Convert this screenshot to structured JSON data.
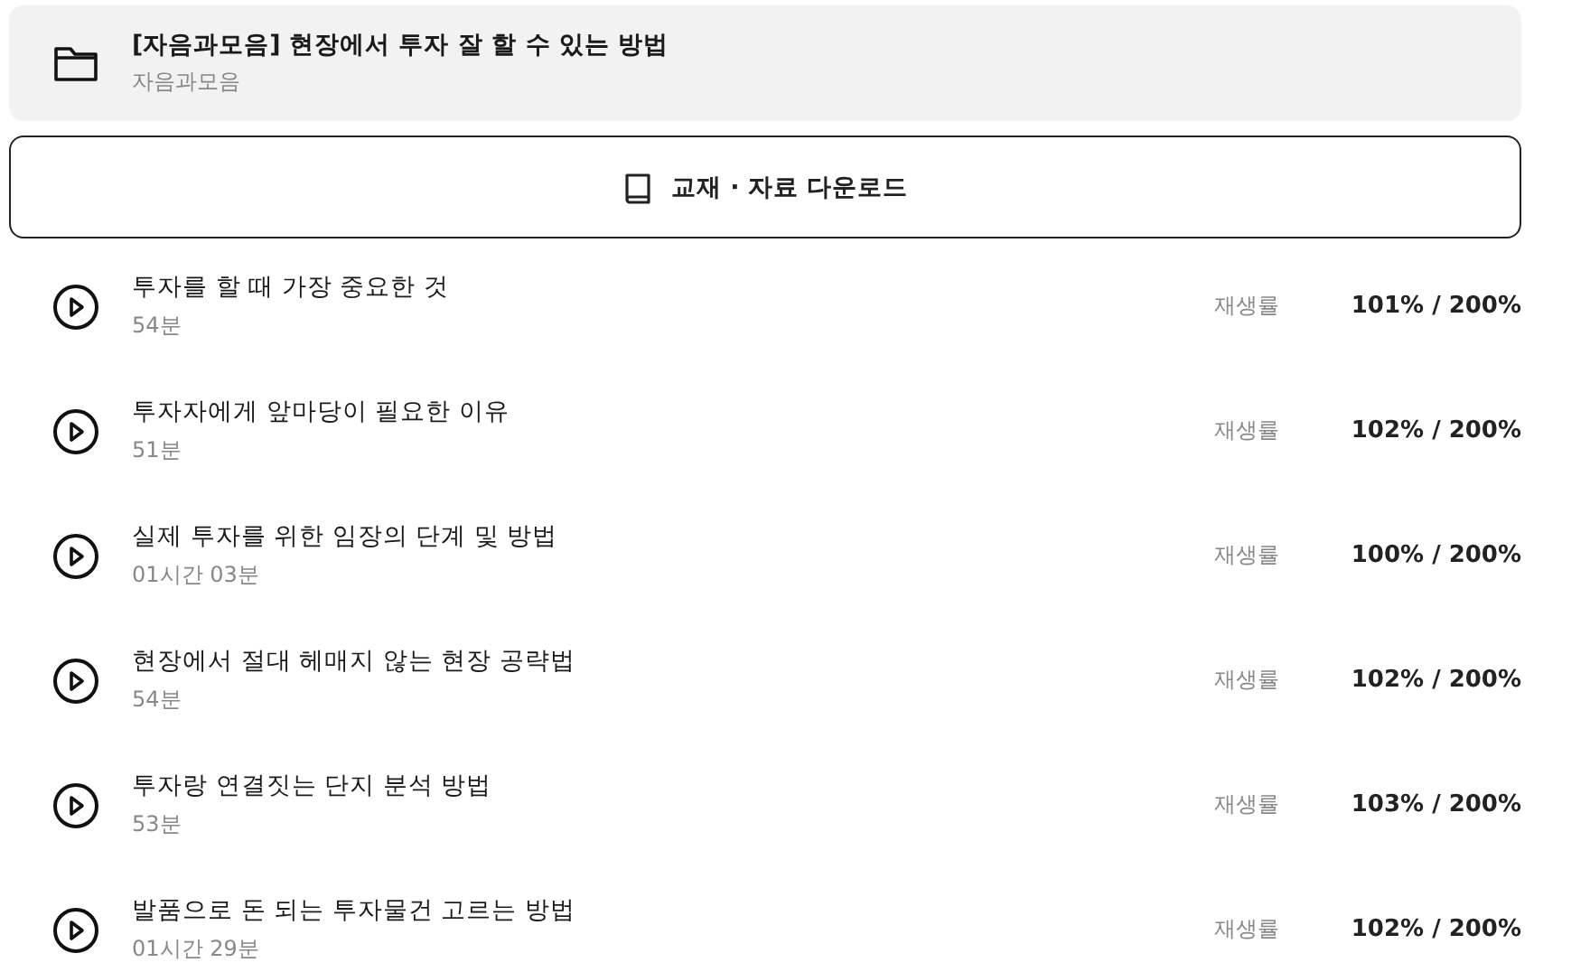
{
  "course": {
    "title": "[자음과모음] 현장에서 투자 잘 할 수 있는 방법",
    "publisher": "자음과모음"
  },
  "download_button": {
    "label": "교재 · 자료 다운로드"
  },
  "lessons": [
    {
      "title": "투자를 할 때 가장 중요한 것",
      "duration": "54분",
      "rate_label": "재생률",
      "rate": "101% / 200%"
    },
    {
      "title": "투자자에게 앞마당이 필요한 이유",
      "duration": "51분",
      "rate_label": "재생률",
      "rate": "102% / 200%"
    },
    {
      "title": "실제 투자를 위한 임장의 단계 및 방법",
      "duration": "01시간 03분",
      "rate_label": "재생률",
      "rate": "100% / 200%"
    },
    {
      "title": "현장에서 절대 헤매지 않는 현장 공략법",
      "duration": "54분",
      "rate_label": "재생률",
      "rate": "102% / 200%"
    },
    {
      "title": "투자랑 연결짓는 단지 분석 방법",
      "duration": "53분",
      "rate_label": "재생률",
      "rate": "103% / 200%"
    },
    {
      "title": "발품으로 돈 되는 투자물건 고르는 방법",
      "duration": "01시간 29분",
      "rate_label": "재생률",
      "rate": "102% / 200%"
    }
  ]
}
